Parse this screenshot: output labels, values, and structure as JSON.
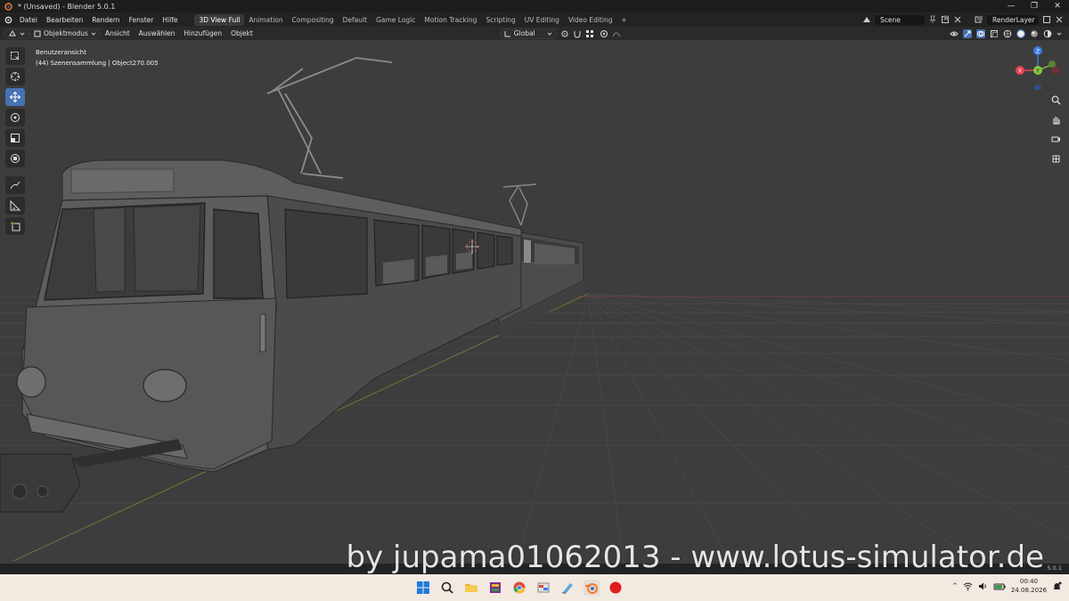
{
  "window": {
    "title": "* (Unsaved) - Blender 5.0.1",
    "controls": [
      "—",
      "❐",
      "✕"
    ]
  },
  "menu": {
    "items": [
      "Datei",
      "Bearbeiten",
      "Rendern",
      "Fenster",
      "Hilfe"
    ],
    "workspaces": [
      "3D View Full",
      "Animation",
      "Compositing",
      "Default",
      "Game Logic",
      "Motion Tracking",
      "Scripting",
      "UV Editing",
      "Video Editing"
    ],
    "active_workspace": "3D View Full",
    "add_tab": "+",
    "scene": "Scene",
    "render_layer": "RenderLayer"
  },
  "header": {
    "mode": "Objektmodus",
    "items": [
      "Ansicht",
      "Auswählen",
      "Hinzufügen",
      "Objekt"
    ],
    "transform_orientation": "Global"
  },
  "viewport": {
    "view_name": "Benutzeransicht",
    "collection_info": "(44) Szenensammlung | Object270.005",
    "gizmo": {
      "x": "X",
      "y": "Y",
      "z": "Z"
    }
  },
  "status": {
    "version": "5.0.1"
  },
  "watermark": "by jupama01062013 - www.lotus-simulator.de",
  "taskbar": {
    "time": "00:40",
    "date": "24.08.2026",
    "tray_arrow": "^"
  },
  "colors": {
    "active_blue": "#4772b3",
    "axis_x": "#e8434f",
    "axis_y": "#8ac43f",
    "axis_z": "#3b7de6"
  }
}
